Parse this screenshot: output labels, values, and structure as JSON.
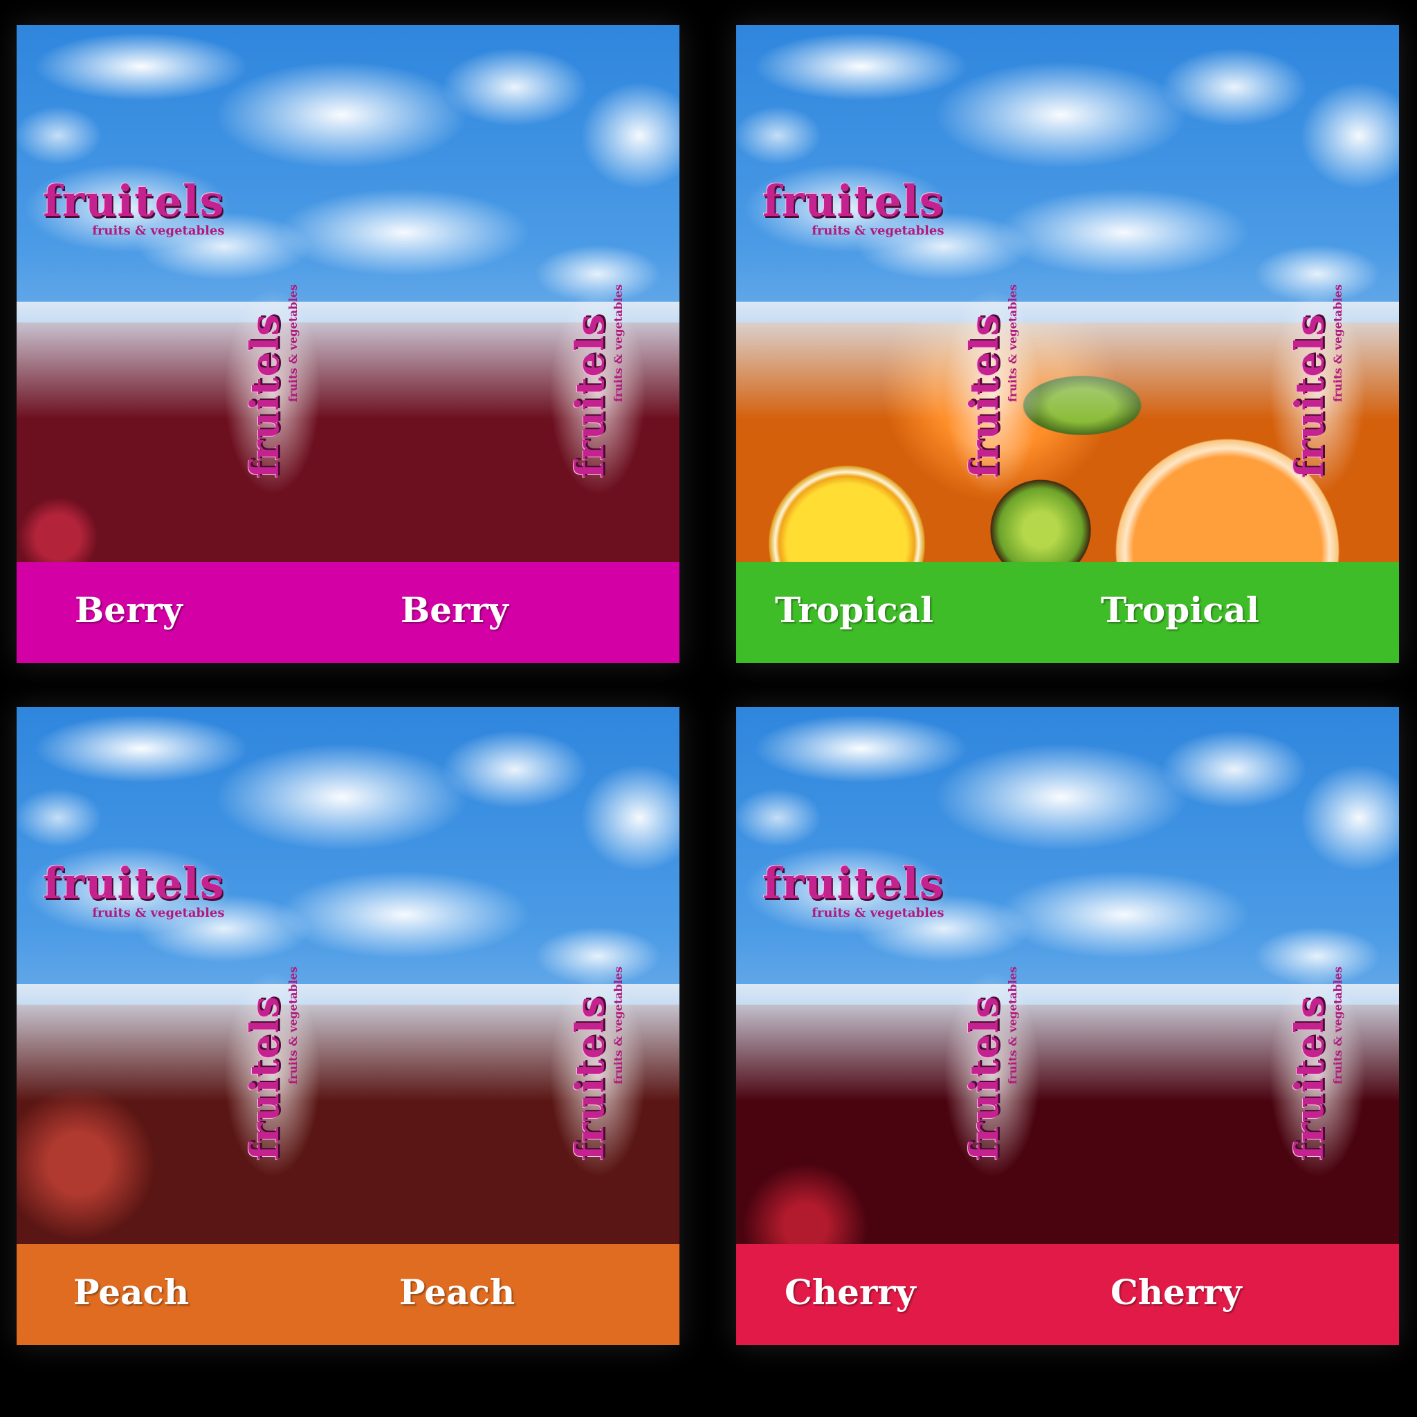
{
  "brand": {
    "name": "fruitels",
    "tagline": "fruits & vegetables"
  },
  "panels": [
    {
      "label": "Berry",
      "band_color": "#d300a5",
      "fruit": "berry"
    },
    {
      "label": "Tropical",
      "band_color": "#3fbd28",
      "fruit": "tropical"
    },
    {
      "label": "Peach",
      "band_color": "#df6c20",
      "fruit": "peach"
    },
    {
      "label": "Cherry",
      "band_color": "#e21a47",
      "fruit": "cherry"
    }
  ]
}
